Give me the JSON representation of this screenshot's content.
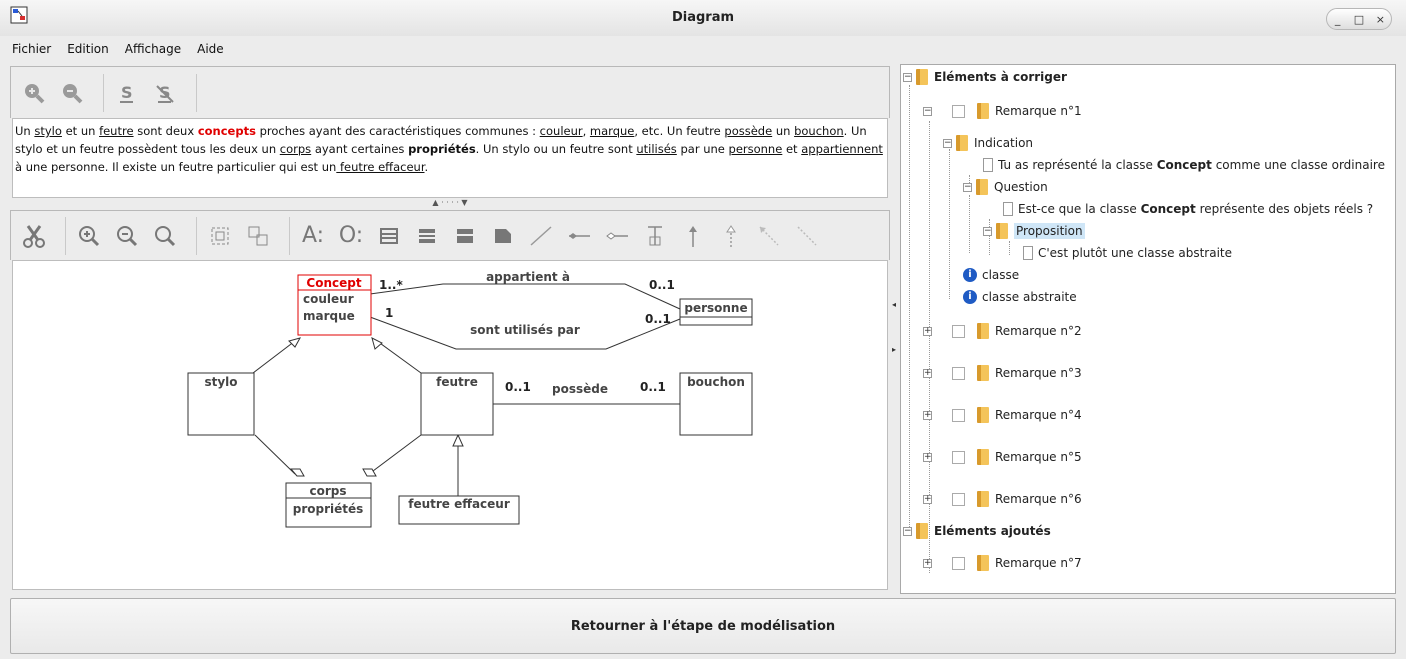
{
  "window": {
    "title": "Diagram",
    "buttons": [
      "_",
      "□",
      "×"
    ]
  },
  "menu": [
    "Fichier",
    "Edition",
    "Affichage",
    "Aide"
  ],
  "text_panel": {
    "segments": [
      {
        "t": "Un "
      },
      {
        "t": "stylo",
        "u": true
      },
      {
        "t": " et un "
      },
      {
        "t": "feutre",
        "u": true
      },
      {
        "t": " sont deux "
      },
      {
        "t": "concepts",
        "hl": true
      },
      {
        "t": " proches ayant des caractéristiques communes : "
      },
      {
        "t": "couleur",
        "u": true
      },
      {
        "t": ", "
      },
      {
        "t": "marque",
        "u": true
      },
      {
        "t": ", etc. Un feutre "
      },
      {
        "t": "possède",
        "u": true
      },
      {
        "t": " un "
      },
      {
        "t": "bouchon",
        "u": true
      },
      {
        "t": ". "
      },
      {
        "t": "Un stylo et un feutre possèdent tous les deux un "
      },
      {
        "t": "corps",
        "u": true
      },
      {
        "t": " ayant certaines "
      },
      {
        "t": "propriétés",
        "b": true
      },
      {
        "t": ". Un stylo ou un feutre sont "
      },
      {
        "t": "utilisés",
        "u": true
      },
      {
        "t": " par une "
      },
      {
        "t": "personne",
        "u": true
      },
      {
        "t": " et "
      },
      {
        "t": "appartiennent",
        "u": true
      },
      {
        "t": " à une personne. Il existe un feutre particulier qui est un"
      },
      {
        "t": " feutre effaceur",
        "u": true
      },
      {
        "t": "."
      }
    ]
  },
  "diagram": {
    "classes": {
      "concept": {
        "name": "Concept",
        "attrs": [
          "couleur",
          "marque"
        ]
      },
      "personne": {
        "name": "personne"
      },
      "stylo": {
        "name": "stylo"
      },
      "feutre": {
        "name": "feutre"
      },
      "bouchon": {
        "name": "bouchon"
      },
      "corps": {
        "name": "corps",
        "attrs": [
          "propriétés"
        ]
      },
      "feutre_effaceur": {
        "name": "feutre effaceur"
      }
    },
    "associations": {
      "appartient": {
        "label": "appartient à",
        "m1": "1..*",
        "m2": "0..1"
      },
      "utilises": {
        "label": "sont utilisés par",
        "m1": "1",
        "m2": "0..1"
      },
      "possede": {
        "label": "possède",
        "m1": "0..1",
        "m2": "0..1"
      }
    },
    "highlight_color": "#e00000"
  },
  "tree": {
    "root1": "Eléments à corriger",
    "rem1": "Remarque n°1",
    "indication": "Indication",
    "indication_text_pre": "Tu as représenté la classe ",
    "indication_text_bold": "Concept",
    "indication_text_post": " comme une classe ordinaire",
    "question": "Question",
    "question_text_pre": "Est-ce que la classe ",
    "question_text_bold": "Concept",
    "question_text_post": " représente des objets réels ?",
    "proposition": "Proposition",
    "proposition_text": "C'est plutôt une classe abstraite",
    "info1": "classe",
    "info2": "classe abstraite",
    "rem2": "Remarque n°2",
    "rem3": "Remarque n°3",
    "rem4": "Remarque n°4",
    "rem5": "Remarque n°5",
    "rem6": "Remarque n°6",
    "root2": "Eléments ajoutés",
    "rem7": "Remarque n°7"
  },
  "bottom_button": "Retourner à l'étape de modélisation"
}
